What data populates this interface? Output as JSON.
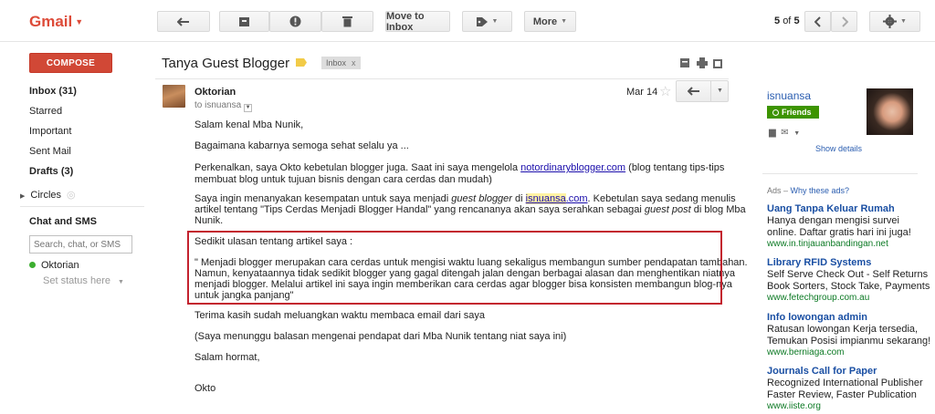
{
  "app": {
    "logo": "Gmail"
  },
  "toolbar": {
    "move_to_inbox": "Move to Inbox",
    "more": "More",
    "count_current": "5",
    "count_of": "of",
    "count_total": "5"
  },
  "sidebar": {
    "compose": "COMPOSE",
    "items": [
      {
        "label": "Inbox (31)",
        "bold": true
      },
      {
        "label": "Starred",
        "bold": false
      },
      {
        "label": "Important",
        "bold": false
      },
      {
        "label": "Sent Mail",
        "bold": false
      },
      {
        "label": "Drafts (3)",
        "bold": true
      }
    ],
    "circles": "Circles",
    "chat_title": "Chat and SMS",
    "chat_placeholder": "Search, chat, or SMS",
    "presence_name": "Oktorian",
    "status": "Set status here"
  },
  "thread": {
    "subject": "Tanya Guest Blogger",
    "chip": "Inbox",
    "chip_x": "x",
    "sender": "Oktorian",
    "to": "to isnuansa",
    "date": "Mar 14"
  },
  "body": {
    "p1": "Salam kenal Mba Nunik,",
    "p2": "Bagaimana kabarnya semoga sehat selalu ya ...",
    "p3a": "Perkenalkan, saya Okto kebetulan blogger juga. Saat ini saya mengelola ",
    "p3link": "notordinaryblogger.com",
    "p3b": " (blog tentang tips-tips",
    "p3c": "membuat blog untuk tujuan bisnis dengan cara cerdas dan mudah)",
    "p4a": "Saya ingin menanyakan kesempatan untuk saya menjadi ",
    "p4i1": "guest blogger",
    "p4b": " di ",
    "p4hl": "isnuansa",
    "p4dot": ".com",
    "p4c": ". Kebetulan saya sedang menulis",
    "p4d": "artikel tentang \"Tips Cerdas Menjadi Blogger Handal\" yang rencananya akan saya serahkan sebagai ",
    "p4i2": "guest post",
    "p4e": " di blog Mba",
    "p4f": "Nunik.",
    "q_head": "Sedikit ulasan tentang artikel saya :",
    "q1": "\" Menjadi blogger merupakan cara cerdas untuk mengisi waktu luang sekaligus membangun sumber pendapatan tambahan.",
    "q2": "Namun, kenyataannya tidak sedikit blogger yang gagal ditengah jalan dengan berbagai alasan dan menghentikan niatnya",
    "q3": "menjadi blogger. Melalui artikel ini saya ingin memberikan cara cerdas agar blogger bisa konsisten membangun blog-nya",
    "q4": "untuk jangka panjang\"",
    "p5": "Terima kasih sudah meluangkan waktu membaca email dari saya",
    "p6": "(Saya menunggu balasan mengenai pendapat dari Mba Nunik tentang niat saya ini)",
    "p7": "Salam hormat,",
    "p8": "Okto"
  },
  "contact": {
    "name": "isnuansa",
    "badge": "Friends",
    "show_details": "Show details"
  },
  "ads": {
    "label": "Ads –",
    "why": "Why these ads?",
    "items": [
      {
        "title": "Uang Tanpa Keluar Rumah",
        "desc1": "Hanya dengan mengisi survei",
        "desc2": "online. Daftar gratis hari ini juga!",
        "url": "www.in.tinjauanbandingan.net"
      },
      {
        "title": "Library RFID Systems",
        "desc1": "Self Serve Check Out - Self Returns",
        "desc2": "Book Sorters, Stock Take, Payments",
        "url": "www.fetechgroup.com.au"
      },
      {
        "title": "Info lowongan admin",
        "desc1": "Ratusan lowongan Kerja tersedia,",
        "desc2": "Temukan Posisi impianmu sekarang!",
        "url": "www.berniaga.com"
      },
      {
        "title": "Journals Call for Paper",
        "desc1": "Recognized International Publisher",
        "desc2": "Faster Review, Faster Publication",
        "url": "www.iiste.org"
      }
    ]
  }
}
